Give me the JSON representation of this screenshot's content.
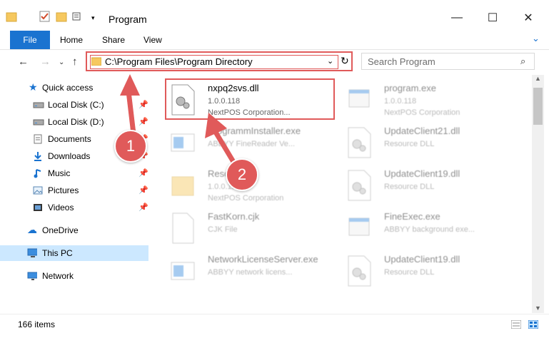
{
  "window": {
    "title": "Program"
  },
  "ribbon": {
    "file": "File",
    "home": "Home",
    "share": "Share",
    "view": "View"
  },
  "address": {
    "path": "C:\\Program Files\\Program Directory"
  },
  "search": {
    "placeholder": "Search Program"
  },
  "sidebar": {
    "quick_access": "Quick access",
    "items": [
      {
        "label": "Local Disk (C:)",
        "icon": "drive-icon",
        "pinned": true
      },
      {
        "label": "Local Disk (D:)",
        "icon": "drive-icon",
        "pinned": true
      },
      {
        "label": "Documents",
        "icon": "documents-icon",
        "pinned": true
      },
      {
        "label": "Downloads",
        "icon": "downloads-icon",
        "pinned": true
      },
      {
        "label": "Music",
        "icon": "music-icon",
        "pinned": true
      },
      {
        "label": "Pictures",
        "icon": "pictures-icon",
        "pinned": true
      },
      {
        "label": "Videos",
        "icon": "videos-icon",
        "pinned": true
      }
    ],
    "onedrive": "OneDrive",
    "thispc": "This PC",
    "network": "Network"
  },
  "files": [
    {
      "name": "nxpq2svs.dll",
      "sub": "1.0.0.118",
      "sub2": "NextPOS Corporation...",
      "icon": "dll-icon"
    },
    {
      "name": "program.exe",
      "sub": "1.0.0.118",
      "sub2": "NextPOS Corporation",
      "icon": "exe-icon"
    },
    {
      "name": "ProgrammInstaller.exe",
      "sub": "ABBYY FineReader Ve...",
      "sub2": "",
      "icon": "installer-icon"
    },
    {
      "name": "UpdateClient21.dll",
      "sub": "Resource DLL",
      "sub2": "",
      "icon": "dll-icon"
    },
    {
      "name": "Resources",
      "sub": "1.0.0.118",
      "sub2": "NextPOS Corporation",
      "icon": "folder-icon"
    },
    {
      "name": "UpdateClient19.dll",
      "sub": "Resource DLL",
      "sub2": "",
      "icon": "dll-icon"
    },
    {
      "name": "FastKorn.cjk",
      "sub": "CJK File",
      "sub2": "",
      "icon": "file-icon"
    },
    {
      "name": "FineExec.exe",
      "sub": "ABBYY background exe...",
      "sub2": "",
      "icon": "exe-icon"
    },
    {
      "name": "NetworkLicenseServer.exe",
      "sub": "ABBYY network licens...",
      "sub2": "",
      "icon": "installer-icon"
    },
    {
      "name": "UpdateClient19.dll",
      "sub": "Resource DLL",
      "sub2": "",
      "icon": "dll-icon"
    }
  ],
  "status": {
    "count": "166 items"
  },
  "callouts": {
    "one": "1",
    "two": "2"
  },
  "colors": {
    "accent": "#1a73d0",
    "highlight": "#e05a5a",
    "selected": "#cce8ff"
  }
}
